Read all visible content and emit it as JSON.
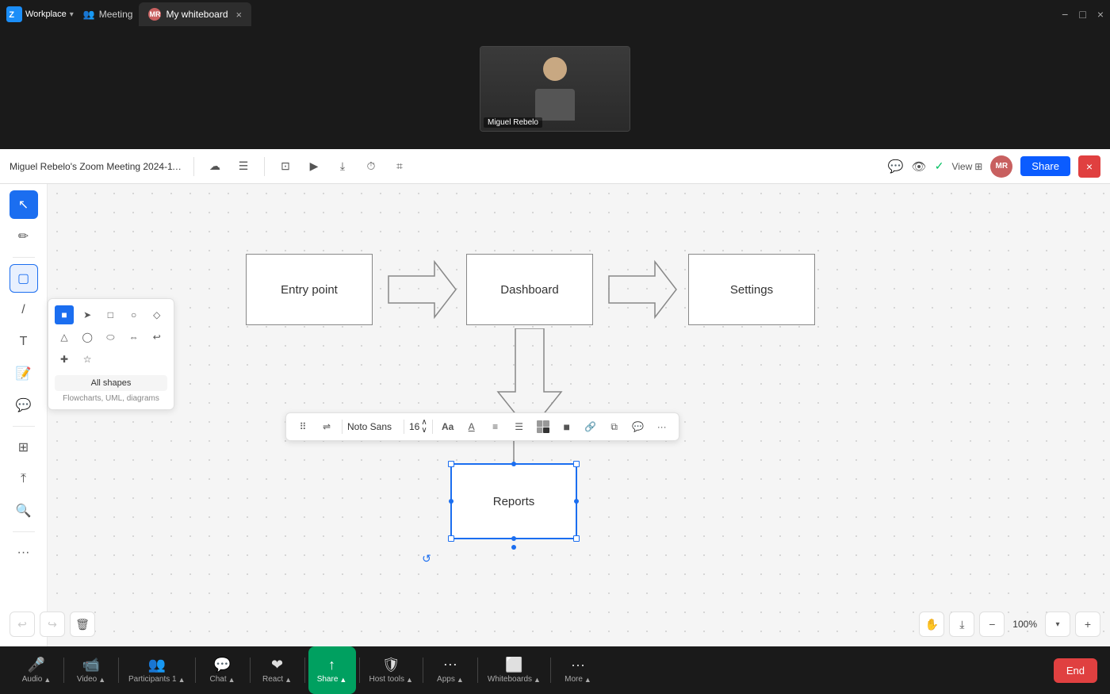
{
  "titlebar": {
    "app_name": "Zoom",
    "workplace_label": "Workplace",
    "dropdown_arrow": "▾",
    "meeting_label": "Meeting",
    "tab_label": "My whiteboard",
    "tab_close": "×",
    "mr_initials": "MR",
    "view_label": "View",
    "window_controls": [
      "−",
      "□",
      "×"
    ]
  },
  "video": {
    "name_label": "Miguel Rebelo"
  },
  "toolbar": {
    "meeting_title": "Miguel Rebelo's Zoom Meeting 2024-11-...",
    "share_label": "Share",
    "view_label": "View",
    "mr_initials": "MR",
    "green_check": "✓"
  },
  "canvas": {
    "shapes": [
      {
        "id": "entry-point",
        "label": "Entry point",
        "type": "rect"
      },
      {
        "id": "arrow1",
        "label": "",
        "type": "right-arrow"
      },
      {
        "id": "dashboard",
        "label": "Dashboard",
        "type": "rect"
      },
      {
        "id": "arrow2",
        "label": "",
        "type": "right-arrow"
      },
      {
        "id": "settings",
        "label": "Settings",
        "type": "rect"
      },
      {
        "id": "down-arrow",
        "label": "",
        "type": "down-arrow"
      },
      {
        "id": "reports",
        "label": "Reports",
        "type": "rect-selected"
      }
    ]
  },
  "format_toolbar": {
    "font_name": "Noto Sans",
    "font_size": "16",
    "chevron_up": "∧",
    "chevron_down": "∨",
    "more_btn": "···"
  },
  "shapes_panel": {
    "all_shapes_label": "All shapes",
    "subtitle": "Flowcharts, UML, diagrams"
  },
  "bottom_controls": {
    "undo_label": "↩",
    "redo_label": "↪",
    "delete_label": "🗑",
    "zoom_level": "100%",
    "zoom_in": "+",
    "zoom_out": "−"
  },
  "bottom_bar": {
    "items": [
      {
        "id": "audio",
        "icon": "🎤",
        "label": "Audio",
        "has_arrow": true
      },
      {
        "id": "video",
        "icon": "📹",
        "label": "Video",
        "has_arrow": true
      },
      {
        "id": "participants",
        "icon": "👥",
        "label": "Participants",
        "badge": "1",
        "has_arrow": true
      },
      {
        "id": "chat",
        "icon": "💬",
        "label": "Chat",
        "has_arrow": true
      },
      {
        "id": "react",
        "icon": "❤",
        "label": "React",
        "has_arrow": true
      },
      {
        "id": "share",
        "icon": "↑",
        "label": "Share",
        "has_arrow": true,
        "highlighted": true
      },
      {
        "id": "host-tools",
        "icon": "🛡",
        "label": "Host tools",
        "has_arrow": true
      },
      {
        "id": "apps",
        "icon": "⋯",
        "label": "Apps",
        "has_arrow": true
      },
      {
        "id": "whiteboards",
        "icon": "⬜",
        "label": "Whiteboards",
        "has_arrow": true
      },
      {
        "id": "more",
        "icon": "···",
        "label": "More",
        "has_arrow": true
      }
    ],
    "end_label": "End"
  }
}
